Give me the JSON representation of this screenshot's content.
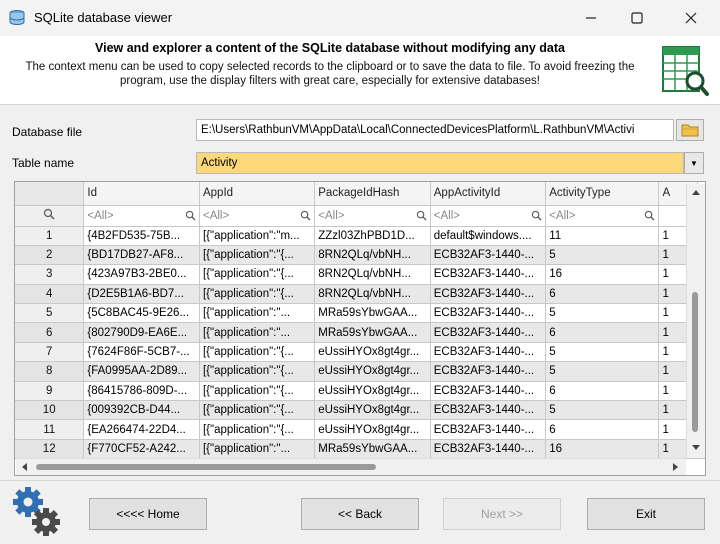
{
  "window": {
    "title": "SQLite database viewer"
  },
  "header": {
    "title": "View and explorer a content of the SQLite database without modifying any data",
    "description": "The context menu can be used to copy selected records to the clipboard or to save the data to file. To avoid freezing the program, use the display filters with great care, especially for extensive databases!"
  },
  "form": {
    "database_label": "Database file",
    "database_value": "E:\\Users\\RathbunVM\\AppData\\Local\\ConnectedDevicesPlatform\\L.RathbunVM\\Activi",
    "table_label": "Table name",
    "table_value": "Activity",
    "table_bg": "#fdd87a"
  },
  "grid": {
    "columns": [
      "Id",
      "AppId",
      "PackageIdHash",
      "AppActivityId",
      "ActivityType",
      "A"
    ],
    "filter_placeholder": "<All>",
    "rows": [
      {
        "n": "1",
        "c": [
          "{4B2FD535-75B...",
          "[{\"application\":\"m...",
          "ZZzl03ZhPBD1D...",
          "default$windows....",
          "11",
          "1"
        ]
      },
      {
        "n": "2",
        "c": [
          "{BD17DB27-AF8...",
          "[{\"application\":\"{...",
          "8RN2QLq/vbNH...",
          "ECB32AF3-1440-...",
          "5",
          "1"
        ]
      },
      {
        "n": "3",
        "c": [
          "{423A97B3-2BE0...",
          "[{\"application\":\"{...",
          "8RN2QLq/vbNH...",
          "ECB32AF3-1440-...",
          "16",
          "1"
        ]
      },
      {
        "n": "4",
        "c": [
          "{D2E5B1A6-BD7...",
          "[{\"application\":\"{...",
          "8RN2QLq/vbNH...",
          "ECB32AF3-1440-...",
          "6",
          "1"
        ]
      },
      {
        "n": "5",
        "c": [
          "{5C8BAC45-9E26...",
          "[{\"application\":\"...",
          "MRa59sYbwGAA...",
          "ECB32AF3-1440-...",
          "5",
          "1"
        ]
      },
      {
        "n": "6",
        "c": [
          "{802790D9-EA6E...",
          "[{\"application\":\"...",
          "MRa59sYbwGAA...",
          "ECB32AF3-1440-...",
          "6",
          "1"
        ]
      },
      {
        "n": "7",
        "c": [
          "{7624F86F-5CB7-...",
          "[{\"application\":\"{...",
          "eUssiHYOx8gt4gr...",
          "ECB32AF3-1440-...",
          "5",
          "1"
        ]
      },
      {
        "n": "8",
        "c": [
          "{FA0995AA-2D89...",
          "[{\"application\":\"{...",
          "eUssiHYOx8gt4gr...",
          "ECB32AF3-1440-...",
          "5",
          "1"
        ]
      },
      {
        "n": "9",
        "c": [
          "{86415786-809D-...",
          "[{\"application\":\"{...",
          "eUssiHYOx8gt4gr...",
          "ECB32AF3-1440-...",
          "6",
          "1"
        ]
      },
      {
        "n": "10",
        "c": [
          "{009392CB-D44...",
          "[{\"application\":\"{...",
          "eUssiHYOx8gt4gr...",
          "ECB32AF3-1440-...",
          "5",
          "1"
        ]
      },
      {
        "n": "11",
        "c": [
          "{EA266474-22D4...",
          "[{\"application\":\"{...",
          "eUssiHYOx8gt4gr...",
          "ECB32AF3-1440-...",
          "6",
          "1"
        ]
      },
      {
        "n": "12",
        "c": [
          "{F770CF52-A242...",
          "[{\"application\":\"...",
          "MRa59sYbwGAA...",
          "ECB32AF3-1440-...",
          "16",
          "1"
        ]
      }
    ]
  },
  "buttons": {
    "home": "<<<< Home",
    "back": "<< Back",
    "next": "Next >>",
    "exit": "Exit"
  }
}
